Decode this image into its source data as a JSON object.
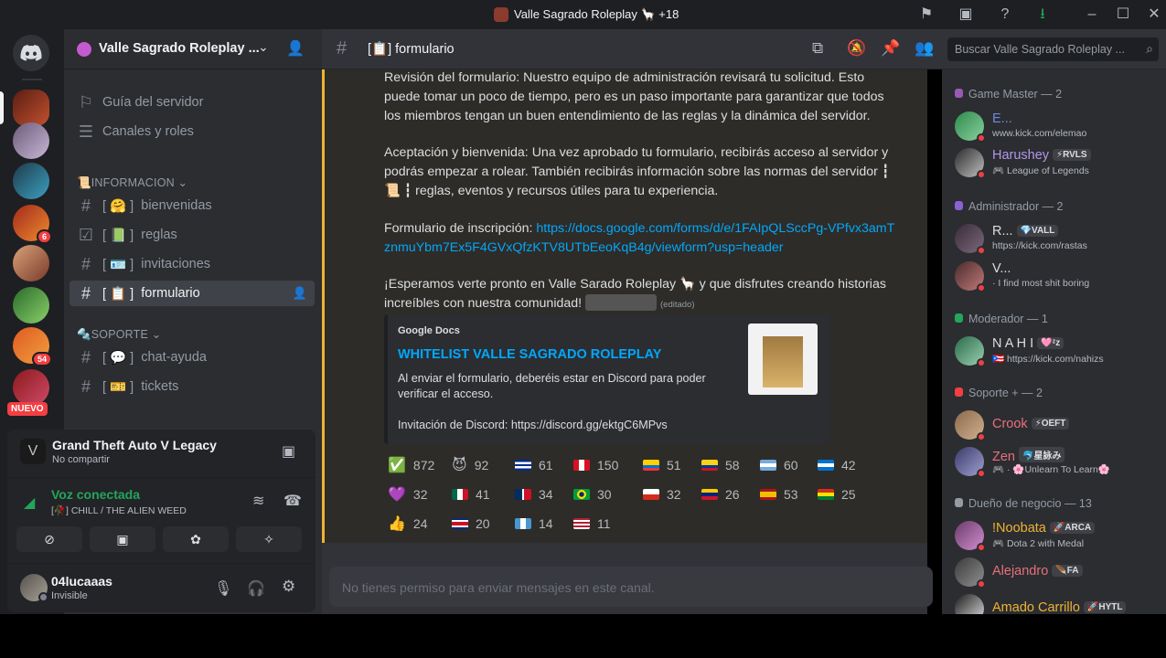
{
  "window": {
    "title": "Valle Sagrado Roleplay 🦙 +18"
  },
  "server": {
    "name": "Valle Sagrado Roleplay ...",
    "guide": "Guía del servidor",
    "channels_roles": "Canales y roles",
    "new_badge": "NUEVO",
    "badges": [
      "6",
      "54"
    ]
  },
  "categories": {
    "info": "📜INFORMACION",
    "support": "🔩SOPORTE"
  },
  "channels": [
    {
      "label": "bienvenidas",
      "emoji": "🤗"
    },
    {
      "label": "reglas",
      "emoji": "📗"
    },
    {
      "label": "invitaciones",
      "emoji": "🪪"
    },
    {
      "label": "formulario",
      "emoji": "📋"
    },
    {
      "label": "chat-ayuda",
      "emoji": "💬"
    },
    {
      "label": "tickets",
      "emoji": "🎫"
    }
  ],
  "activity": {
    "game": "Grand Theft Auto V Legacy",
    "sub": "No compartir"
  },
  "voice": {
    "status": "Voz conectada",
    "channel": "[🥀] CHILL / THE ALIEN WEED"
  },
  "user": {
    "name": "04lucaaas",
    "status": "Invisible"
  },
  "chat": {
    "channel": "[📋] formulario",
    "search_placeholder": "Buscar Valle Sagrado Roleplay ...",
    "para1": "Revisión del formulario: Nuestro equipo de administración revisará tu solicitud. Esto puede tomar un poco de tiempo, pero es un paso importante para garantizar que todos los miembros tengan un buen entendimiento de las reglas y la dinámica del servidor.",
    "para2a": "Aceptación y bienvenida: Una vez aprobado tu formulario, recibirás acceso al servidor y podrás empezar a rolear. También recibirás información sobre las normas del servidor ┇",
    "para2b": "📜 ┇ reglas, eventos y recursos útiles para tu experiencia.",
    "form_label": "Formulario de inscripción: ",
    "form_link": "https://docs.google.com/forms/d/e/1FAIpQLSccPg-VPfvx3amTznmuYbm7Ex5F4GVxQfzKTV8UTbEeoKqB4g/viewform?usp=header",
    "para3": "¡Esperamos verte pronto en Valle Sarado Roleplay 🦙 y que disfrutes creando historias increíbles con nuestra comunidad!",
    "edited": "(editado)",
    "embed": {
      "provider": "Google Docs",
      "title": "WHITELIST VALLE SAGRADO ROLEPLAY",
      "desc": "Al enviar el formulario, deberéis estar en Discord para poder verificar el acceso.",
      "invite": "Invitación de Discord: https://discord.gg/ektgC6MPvs"
    },
    "reactions": [
      {
        "emoji": "✅",
        "count": "872"
      },
      {
        "emoji": "😈",
        "count": "92"
      },
      {
        "emoji": "flag-cu",
        "count": "61"
      },
      {
        "emoji": "flag-pe",
        "count": "150"
      },
      {
        "emoji": "flag-ec",
        "count": "51"
      },
      {
        "emoji": "flag-co",
        "count": "58"
      },
      {
        "emoji": "flag-ar",
        "count": "60"
      },
      {
        "emoji": "flag-hn",
        "count": "42"
      },
      {
        "emoji": "💜",
        "count": "32"
      },
      {
        "emoji": "flag-mx",
        "count": "41"
      },
      {
        "emoji": "flag-do",
        "count": "34"
      },
      {
        "emoji": "flag-br",
        "count": "30"
      },
      {
        "emoji": "flag-cl",
        "count": "32"
      },
      {
        "emoji": "flag-ve",
        "count": "26"
      },
      {
        "emoji": "flag-es",
        "count": "53"
      },
      {
        "emoji": "flag-bo",
        "count": "25"
      },
      {
        "emoji": "👍",
        "count": "24"
      },
      {
        "emoji": "flag-cr",
        "count": "20"
      },
      {
        "emoji": "flag-gt",
        "count": "14"
      },
      {
        "emoji": "flag-us",
        "count": "11"
      }
    ],
    "no_permission": "No tienes permiso para enviar mensajes en este canal."
  },
  "members": {
    "groups": [
      {
        "title": "Game Master — 2"
      },
      {
        "title": "Administrador — 2"
      },
      {
        "title": "Moderador — 1"
      },
      {
        "title": "Soporte + — 2"
      },
      {
        "title": "Dueño de negocio — 13"
      }
    ],
    "list": [
      {
        "name": "E...",
        "sub": "www.kick.com/elemao",
        "color": "#7289da"
      },
      {
        "name": "Harushey",
        "tag": "⚡RVLS",
        "sub": "🎮 League of Legends",
        "color": "#b497e8"
      },
      {
        "name": "R...",
        "tag": "💎VALL",
        "sub": "https://kick.com/rastas",
        "color": "#dbdee1"
      },
      {
        "name": "V...",
        "sub": "· I find most shit boring",
        "color": "#dbdee1"
      },
      {
        "name": "N A H I",
        "tag": "🩷ᶻz",
        "sub": "🇵🇷 https://kick.com/nahizs",
        "color": "#dbdee1"
      },
      {
        "name": "Crook",
        "tag": "⚡OEFT",
        "sub": "",
        "color": "#e8707a"
      },
      {
        "name": "Zen",
        "tag": "🐬星詠み",
        "sub": "🎮 · 🌸Unlearn To Learn🌸",
        "color": "#e8707a"
      },
      {
        "name": "!Noobata",
        "tag": "🚀ARCA",
        "sub": "🎮 Dota 2 with Medal",
        "color": "#f0b232"
      },
      {
        "name": "Alejandro",
        "tag": "🪶FA",
        "sub": "",
        "color": "#e8707a"
      },
      {
        "name": "Amado Carrillo",
        "tag": "🚀HYTL",
        "sub": "",
        "color": "#f0b232"
      }
    ]
  }
}
